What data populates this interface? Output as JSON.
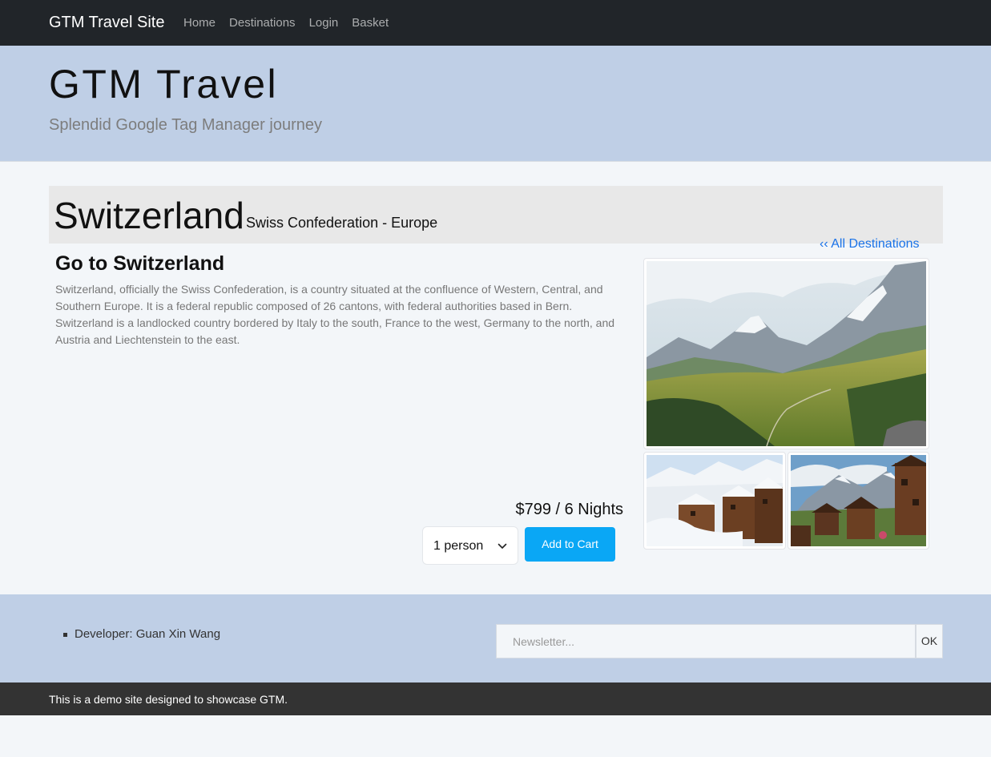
{
  "navbar": {
    "brand": "GTM Travel Site",
    "links": [
      "Home",
      "Destinations",
      "Login",
      "Basket"
    ]
  },
  "hero": {
    "title": "GTM Travel",
    "subtitle": "Splendid Google Tag Manager journey"
  },
  "destination": {
    "name": "Switzerland",
    "subtitle": "Swiss Confederation - Europe",
    "back_link": "‹‹ All Destinations",
    "heading": "Go to Switzerland",
    "description": "Switzerland, officially the Swiss Confederation, is a country situated at the confluence of Western, Central, and Southern Europe. It is a federal republic composed of 26 cantons, with federal authorities based in Bern. Switzerland is a landlocked country bordered by Italy to the south, France to the west, Germany to the north, and Austria and Liechtenstein to the east.",
    "price": "$799 / 6 Nights",
    "person_selected": "1 person",
    "add_to_cart": "Add to Cart"
  },
  "footer": {
    "developer": "Developer: Guan Xin Wang",
    "newsletter_placeholder": "Newsletter...",
    "ok_label": "OK",
    "note": "This is a demo site designed to showcase GTM."
  },
  "colors": {
    "navbar": "#212529",
    "hero": "#bfcfe6",
    "accent": "#0aa7f5",
    "link": "#1a73e8",
    "footer_bar": "#333333"
  }
}
